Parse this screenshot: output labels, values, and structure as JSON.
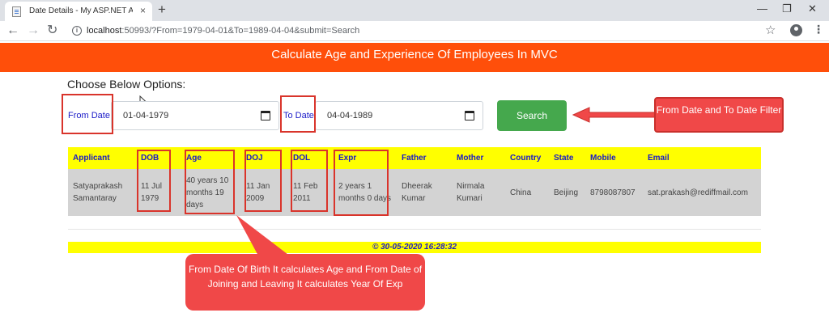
{
  "browser": {
    "tab_title": "Date Details - My ASP.NET Application",
    "tab_close": "×",
    "new_tab": "+",
    "url_host": "localhost",
    "url_rest": ":50993/?From=1979-04-01&To=1989-04-04&submit=Search",
    "win_min": "—",
    "win_restore": "❐",
    "win_close": "✕",
    "back": "←",
    "forward": "→",
    "reload": "↻",
    "star": "☆",
    "menu": "⋮",
    "info": "i"
  },
  "page": {
    "banner": "Calculate Age and Experience Of Employees In MVC",
    "choose_label": "Choose Below Options:",
    "from_label": "From Date:",
    "from_value": "01-04-1979",
    "to_label": "To Date:",
    "to_value": "04-04-1989",
    "search_button": "Search"
  },
  "table": {
    "headers": [
      "Applicant",
      "DOB",
      "Age",
      "DOJ",
      "DOL",
      "Expr",
      "Father",
      "Mother",
      "Country",
      "State",
      "Mobile",
      "Email"
    ],
    "rows": [
      [
        "Satyaprakash Samantaray",
        "11 Jul 1979",
        "40 years 10 months 19 days",
        "11 Jan 2009",
        "11 Feb 2011",
        "2 years 1 months 0 days",
        "Dheerak Kumar",
        "Nirmala Kumari",
        "China",
        "Beijing",
        "8798087807",
        "sat.prakash@rediffmail.com"
      ]
    ]
  },
  "footer": "© 30-05-2020 16:28:32",
  "annotations": {
    "filter_callout": "From Date and To Date Filter",
    "calc_callout": "From Date Of Birth It calculates Age and From Date of Joining and Leaving It calculates Year Of Exp"
  },
  "colors": {
    "banner": "#ff4f0a",
    "search_button": "#45a84d",
    "table_header": "#ffff00",
    "callout": "#f04848",
    "highlight_box": "#d9342b"
  }
}
